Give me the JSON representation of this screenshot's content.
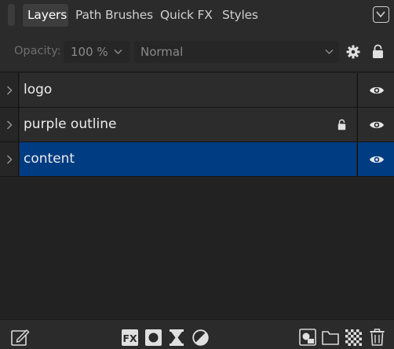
{
  "tabs": [
    {
      "label": "Layers",
      "active": true
    },
    {
      "label": "Path Brushes",
      "active": false
    },
    {
      "label": "Quick FX",
      "active": false
    },
    {
      "label": "Styles",
      "active": false
    }
  ],
  "panel_menu_icon": "chevron-down-in-box-icon",
  "controls": {
    "opacity_label": "Opacity:",
    "opacity_value": "100 %",
    "blend_mode": "Normal",
    "settings_icon": "gear-icon",
    "lock_icon": "lock-icon"
  },
  "layers": [
    {
      "name": "logo",
      "locked": false,
      "visible": true,
      "selected": false
    },
    {
      "name": "purple outline",
      "locked": true,
      "visible": true,
      "selected": false
    },
    {
      "name": "content",
      "locked": false,
      "visible": true,
      "selected": true
    }
  ],
  "colors": {
    "selection": "#003c82",
    "panel_bg": "#222222",
    "bar_bg": "#2b2b2b"
  },
  "bottom_toolbar_icons": [
    "edit-icon",
    "fx-icon",
    "mask-icon",
    "adjustment-icon",
    "halftone-icon",
    "add-pixel-layer-icon",
    "add-group-icon",
    "transparency-icon",
    "delete-icon"
  ]
}
